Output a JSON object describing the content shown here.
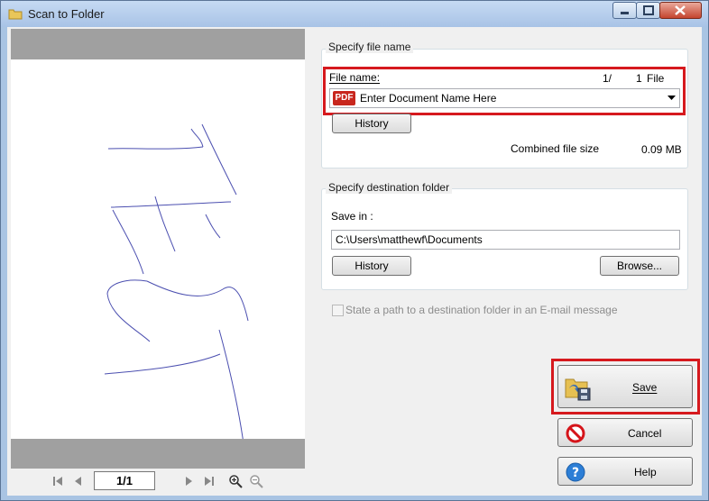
{
  "window": {
    "title": "Scan to Folder"
  },
  "preview": {
    "page_indicator": "1/1"
  },
  "file_name_group": {
    "title": "Specify file name",
    "file_name_label": "File name:",
    "file_counter": "1/",
    "file_count": "1",
    "file_unit": "File",
    "pdf_badge": "PDF",
    "file_name_value": "Enter Document Name Here",
    "history_button": "History",
    "combined_size_label": "Combined file size",
    "combined_size_value": "0.09 MB"
  },
  "destination_group": {
    "title": "Specify destination folder",
    "save_in_label": "Save in :",
    "save_in_value": "C:\\Users\\matthewf\\Documents",
    "history_button": "History",
    "browse_button": "Browse..."
  },
  "email_checkbox": {
    "label": "State a path to a destination folder in an E-mail message",
    "checked": false
  },
  "actions": {
    "save": "Save",
    "cancel": "Cancel",
    "help": "Help"
  }
}
